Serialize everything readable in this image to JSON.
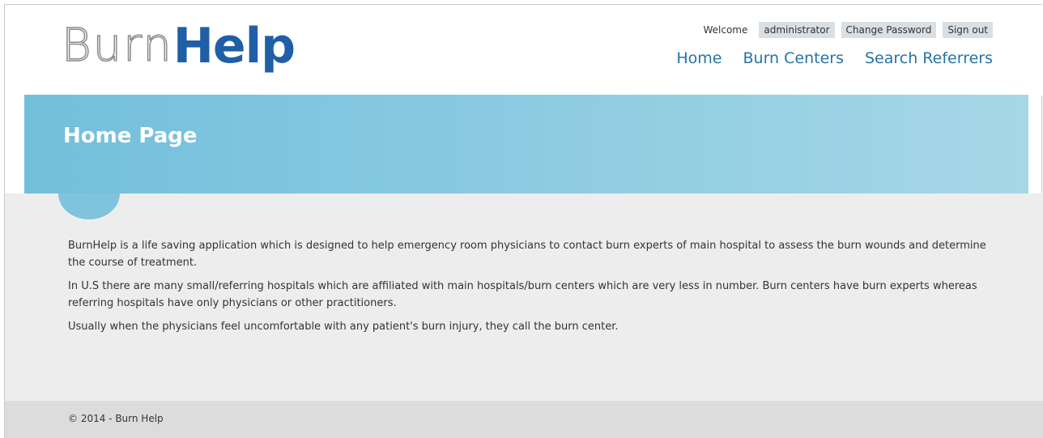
{
  "logo": {
    "part1": "Burn",
    "part2": "Help"
  },
  "login": {
    "welcome": "Welcome",
    "username": "administrator",
    "change_password": "Change Password",
    "sign_out": "Sign out"
  },
  "nav": {
    "home": "Home",
    "burn_centers": "Burn Centers",
    "search_referrers": "Search Referrers"
  },
  "banner": {
    "title": "Home Page"
  },
  "content": {
    "paragraphs": [
      "BurnHelp is a life saving application which is designed to help emergency room physicians to contact burn experts of main hospital to assess the burn wounds and determine the course of treatment.",
      "In U.S there are many small/referring hospitals which are affiliated with main hospitals/burn centers which are very less in number. Burn centers have burn experts whereas referring hospitals have only physicians or other practitioners.",
      "Usually when the physicians feel uncomfortable with any patient's burn injury, they call the burn center."
    ]
  },
  "footer": {
    "copyright": "© 2014 - Burn Help"
  },
  "colors": {
    "brand_blue": "#1f5fa8",
    "link_blue": "#2673a8",
    "banner_start": "#72bfdc",
    "banner_end": "#a6d7e7"
  }
}
